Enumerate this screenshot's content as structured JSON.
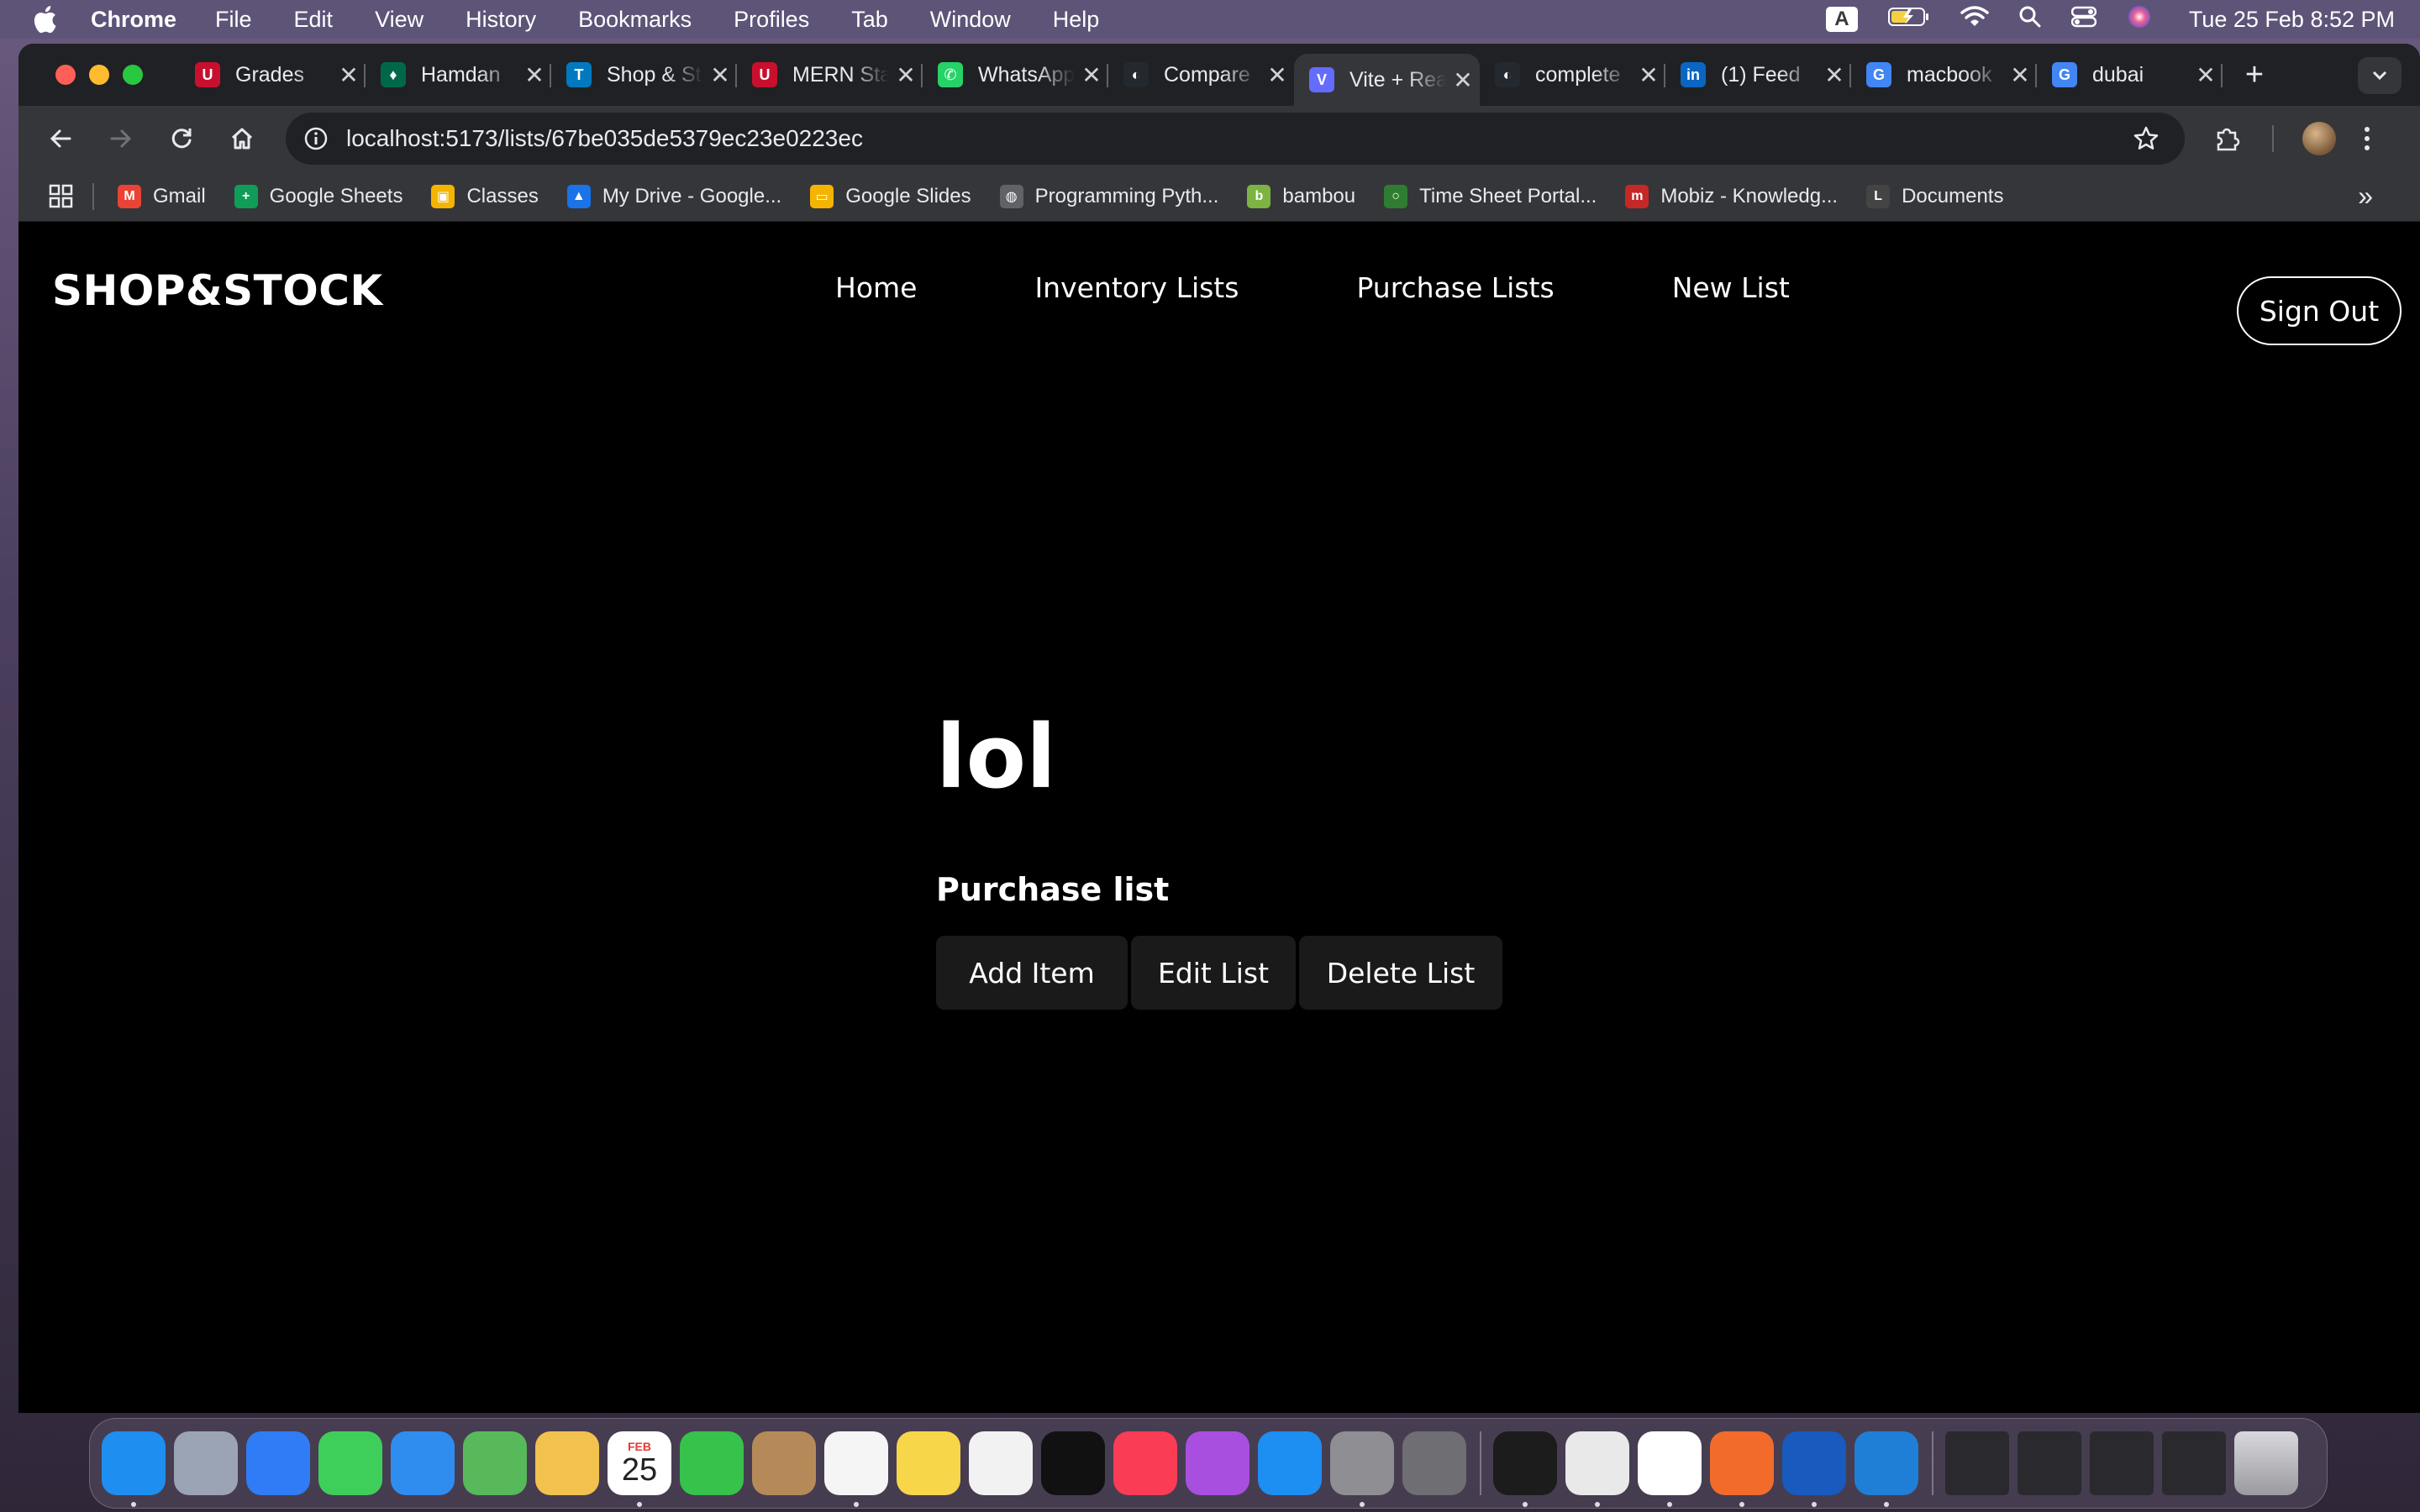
{
  "menubar": {
    "app_name": "Chrome",
    "items": [
      "File",
      "Edit",
      "View",
      "History",
      "Bookmarks",
      "Profiles",
      "Tab",
      "Window",
      "Help"
    ],
    "input_source": "A",
    "clock": "Tue 25 Feb  8:52 PM"
  },
  "tabs": [
    {
      "title": "Grades",
      "favicon_color": "#c8102e",
      "favicon_text": "U"
    },
    {
      "title": "Hamdan",
      "favicon_color": "#00684a",
      "favicon_text": "♦"
    },
    {
      "title": "Shop & Stock",
      "favicon_color": "#0079bf",
      "favicon_text": "T"
    },
    {
      "title": "MERN Stack",
      "favicon_color": "#c8102e",
      "favicon_text": "U"
    },
    {
      "title": "WhatsApp",
      "favicon_color": "#25d366",
      "favicon_text": "✆"
    },
    {
      "title": "Compare",
      "favicon_color": "#24292f",
      "favicon_text": "◐"
    },
    {
      "title": "Vite + React",
      "favicon_color": "#646cff",
      "favicon_text": "V"
    },
    {
      "title": "complete",
      "favicon_color": "#24292f",
      "favicon_text": "◐"
    },
    {
      "title": "(1) Feed",
      "favicon_color": "#0a66c2",
      "favicon_text": "in"
    },
    {
      "title": "macbook",
      "favicon_color": "#4285f4",
      "favicon_text": "G"
    },
    {
      "title": "dubai",
      "favicon_color": "#4285f4",
      "favicon_text": "G"
    }
  ],
  "active_tab_index": 6,
  "address_bar": {
    "url": "localhost:5173/lists/67be035de5379ec23e0223ec"
  },
  "bookmarks": [
    {
      "label": "Gmail",
      "color": "#ea4335",
      "icon": "M"
    },
    {
      "label": "Google Sheets",
      "color": "#0f9d58",
      "icon": "+"
    },
    {
      "label": "Classes",
      "color": "#f4b400",
      "icon": "▣"
    },
    {
      "label": "My Drive - Google...",
      "color": "#1a73e8",
      "icon": "▲"
    },
    {
      "label": "Google Slides",
      "color": "#f4b400",
      "icon": "▭"
    },
    {
      "label": "Programming Pyth...",
      "color": "#5f6368",
      "icon": "◍"
    },
    {
      "label": "bambou",
      "color": "#7cb342",
      "icon": "b"
    },
    {
      "label": "Time Sheet Portal...",
      "color": "#2e7d32",
      "icon": "○"
    },
    {
      "label": "Mobiz - Knowledg...",
      "color": "#c62828",
      "icon": "m"
    },
    {
      "label": "Documents",
      "color": "#444444",
      "icon": "L"
    }
  ],
  "site": {
    "logo": "SHOP&STOCK",
    "nav": [
      "Home",
      "Inventory Lists",
      "Purchase Lists",
      "New List"
    ],
    "sign_out": "Sign Out"
  },
  "list": {
    "title": "lol",
    "type": "Purchase list",
    "actions": {
      "add": "Add Item",
      "edit": "Edit List",
      "delete": "Delete List"
    }
  },
  "dock": {
    "calendar_month": "FEB",
    "calendar_day": "25",
    "apps": [
      {
        "name": "finder",
        "color": "#1e8ef0"
      },
      {
        "name": "launchpad",
        "color": "#9aa4b4"
      },
      {
        "name": "safari",
        "color": "#2f7cf6"
      },
      {
        "name": "messages",
        "color": "#3ecf5a"
      },
      {
        "name": "mail",
        "color": "#2f8df0"
      },
      {
        "name": "maps",
        "color": "#58b95b"
      },
      {
        "name": "photos",
        "color": "#f2c14e"
      },
      {
        "name": "calendar",
        "color": "#ffffff"
      },
      {
        "name": "facetime",
        "color": "#36c24b"
      },
      {
        "name": "contacts",
        "color": "#b58a58"
      },
      {
        "name": "reminders",
        "color": "#f5f5f5"
      },
      {
        "name": "notes",
        "color": "#f7d64a"
      },
      {
        "name": "freeform",
        "color": "#f2f2f2"
      },
      {
        "name": "tv",
        "color": "#111111"
      },
      {
        "name": "music",
        "color": "#fa3c55"
      },
      {
        "name": "podcasts",
        "color": "#a94fe0"
      },
      {
        "name": "app-store",
        "color": "#1d8ef2"
      },
      {
        "name": "system-settings",
        "color": "#8e8e93"
      },
      {
        "name": "iphone-mirroring",
        "color": "#6e6e73"
      },
      {
        "name": "terminal",
        "color": "#1c1c1c"
      },
      {
        "name": "chrome",
        "color": "#e9e9e9"
      },
      {
        "name": "slack",
        "color": "#ffffff"
      },
      {
        "name": "pen-tool",
        "color": "#f26b2b"
      },
      {
        "name": "word",
        "color": "#185abd"
      },
      {
        "name": "vscode",
        "color": "#1f7fd6"
      }
    ],
    "minimized_count": 4
  }
}
